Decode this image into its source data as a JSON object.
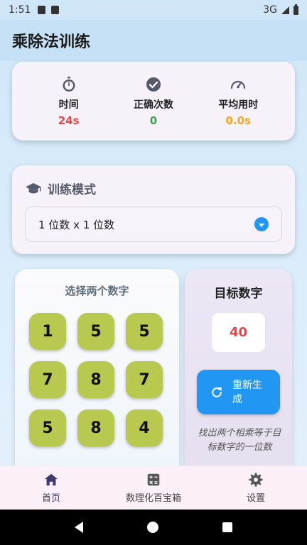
{
  "status_bar": {
    "time": "1:51",
    "network": "3G"
  },
  "app_bar": {
    "title": "乘除法训练"
  },
  "stats": [
    {
      "icon": "stopwatch-icon",
      "label": "时间",
      "value": "24s",
      "color": "#e04848"
    },
    {
      "icon": "check-circle-icon",
      "label": "正确次数",
      "value": "0",
      "color": "#3fa34d"
    },
    {
      "icon": "speedometer-icon",
      "label": "平均用时",
      "value": "0.0s",
      "color": "#f5a623"
    }
  ],
  "mode": {
    "icon": "graduation-cap-icon",
    "title": "训练模式",
    "selected": "1 位数 x 1 位数"
  },
  "picker": {
    "title": "选择两个数字",
    "numbers": [
      "1",
      "5",
      "5",
      "7",
      "8",
      "7",
      "5",
      "8",
      "4"
    ],
    "button_color": "#b9c84f"
  },
  "target": {
    "title": "目标数字",
    "value": "40",
    "regenerate_label": "重新生成",
    "hint": "找出两个相乘等于目标数字的一位数"
  },
  "bottom_nav": [
    {
      "icon": "home-icon",
      "label": "首页",
      "active": true
    },
    {
      "icon": "calculator-icon",
      "label": "数理化百宝箱",
      "active": false
    },
    {
      "icon": "gear-icon",
      "label": "设置",
      "active": false
    }
  ],
  "colors": {
    "accent": "#2196f3",
    "nav_active": "#3f3a70"
  }
}
